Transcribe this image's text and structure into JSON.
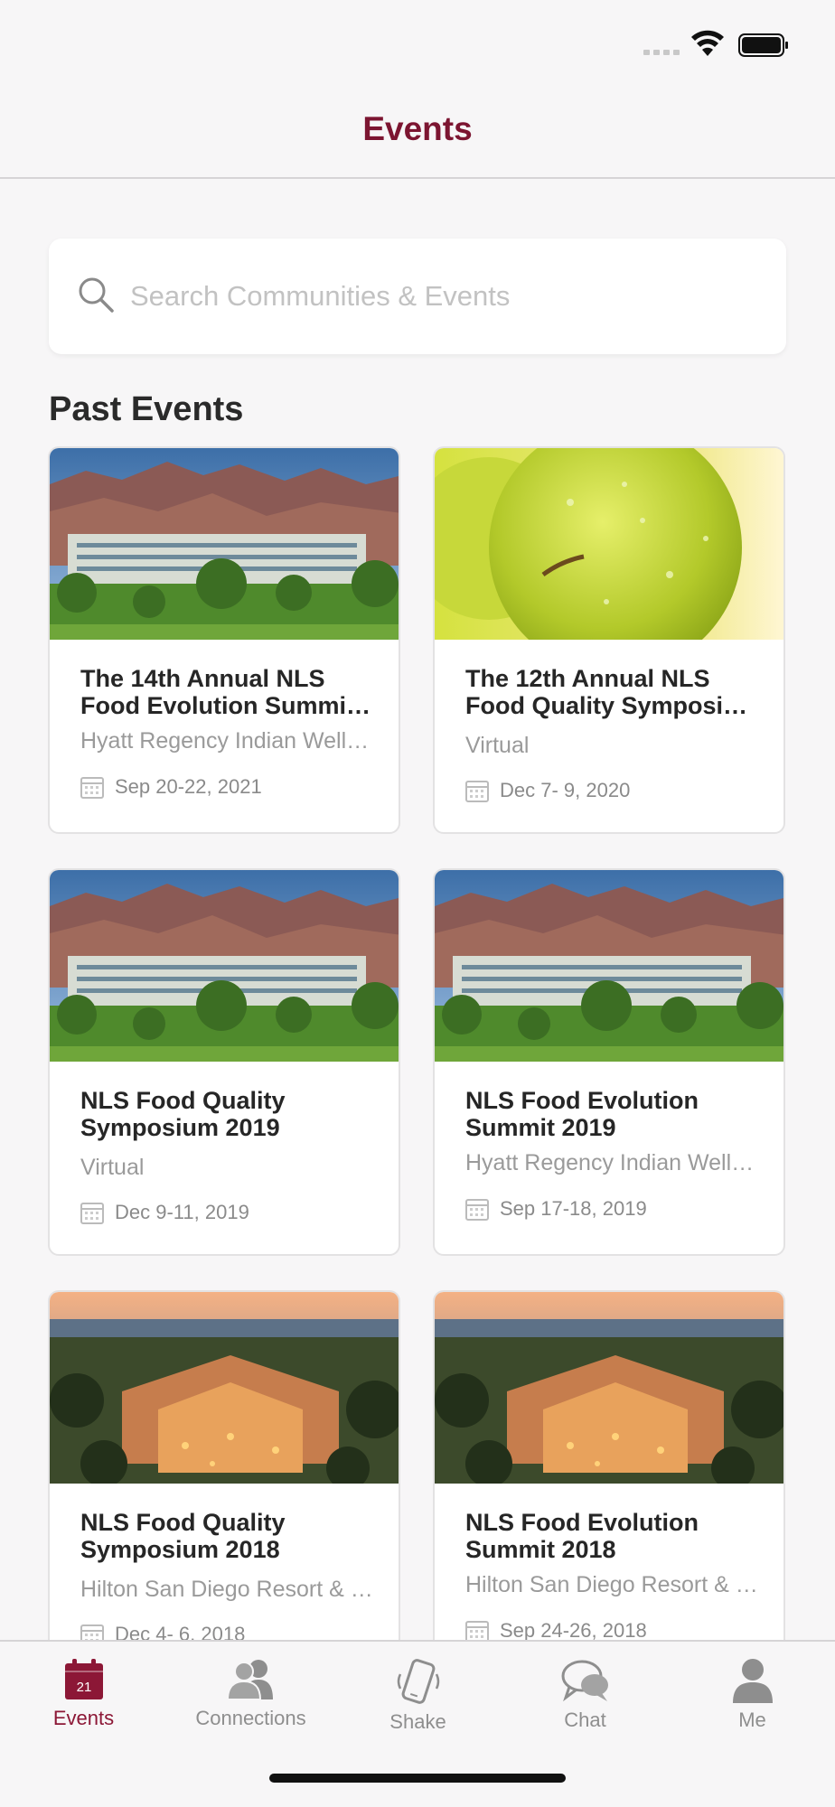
{
  "header": {
    "title": "Events"
  },
  "search": {
    "placeholder": "Search Communities & Events"
  },
  "section": {
    "title": "Past Events"
  },
  "events": [
    {
      "title": "The 14th Annual NLS Food Evolution Summi…",
      "location": "Hyatt Regency Indian Wells…",
      "date": "Sep 20-22, 2021",
      "image": "desert-resort"
    },
    {
      "title": "The 12th Annual NLS Food Quality Symposi…",
      "location": "Virtual",
      "date": "Dec  7- 9, 2020",
      "image": "green-apple"
    },
    {
      "title": "NLS Food Quality Symposium 2019",
      "location": "Virtual",
      "date": "Dec  9-11, 2019",
      "image": "desert-resort"
    },
    {
      "title": "NLS Food Evolution Summit 2019",
      "location": "Hyatt Regency Indian Wells…",
      "date": "Sep 17-18, 2019",
      "image": "desert-resort"
    },
    {
      "title": "NLS Food Quality Symposium 2018",
      "location": "Hilton San Diego Resort & S…",
      "date": "Dec  4- 6, 2018",
      "image": "bay-resort"
    },
    {
      "title": "NLS Food Evolution Summit 2018",
      "location": "Hilton San Diego Resort & S…",
      "date": "Sep 24-26, 2018",
      "image": "bay-resort"
    }
  ],
  "tabs": [
    {
      "label": "Events",
      "icon": "calendar-icon",
      "badge": "21",
      "active": true
    },
    {
      "label": "Connections",
      "icon": "people-icon",
      "active": false
    },
    {
      "label": "Shake",
      "icon": "phone-shake-icon",
      "active": false
    },
    {
      "label": "Chat",
      "icon": "chat-bubbles-icon",
      "active": false
    },
    {
      "label": "Me",
      "icon": "person-icon",
      "active": false
    }
  ],
  "colors": {
    "accent": "#7c1531",
    "tab_inactive": "#8e8e8e"
  }
}
